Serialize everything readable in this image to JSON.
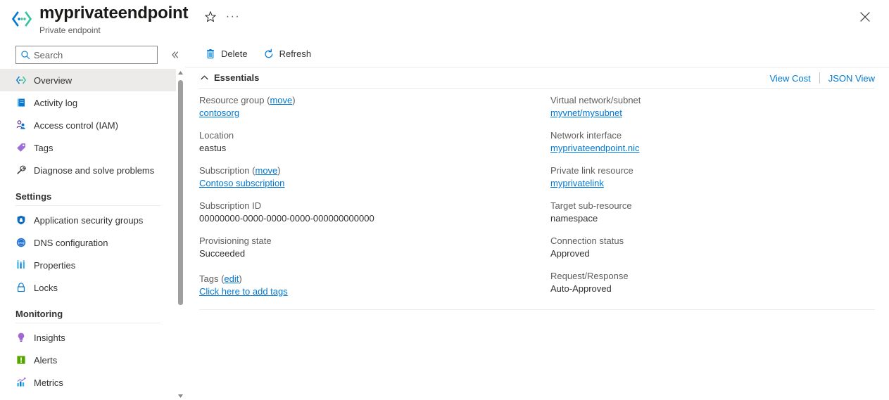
{
  "header": {
    "title": "myprivateendpoint",
    "subtitle": "Private endpoint",
    "resource_icon": "private-endpoint-icon",
    "favorite_icon": "star-icon",
    "more_icon": "ellipsis-icon",
    "close_icon": "close-icon"
  },
  "sidebar": {
    "search": {
      "placeholder": "Search",
      "value": "",
      "icon": "search-icon"
    },
    "collapse_icon": "chevron-double-left-icon",
    "items": [
      {
        "label": "Overview",
        "icon": "private-endpoint-icon",
        "selected": true
      },
      {
        "label": "Activity log",
        "icon": "activity-log-icon",
        "selected": false
      },
      {
        "label": "Access control (IAM)",
        "icon": "access-control-icon",
        "selected": false
      },
      {
        "label": "Tags",
        "icon": "tag-icon",
        "selected": false
      },
      {
        "label": "Diagnose and solve problems",
        "icon": "wrench-icon",
        "selected": false
      }
    ],
    "groups": [
      {
        "title": "Settings",
        "items": [
          {
            "label": "Application security groups",
            "icon": "shield-icon"
          },
          {
            "label": "DNS configuration",
            "icon": "dns-icon"
          },
          {
            "label": "Properties",
            "icon": "properties-icon"
          },
          {
            "label": "Locks",
            "icon": "lock-icon"
          }
        ]
      },
      {
        "title": "Monitoring",
        "items": [
          {
            "label": "Insights",
            "icon": "lightbulb-icon"
          },
          {
            "label": "Alerts",
            "icon": "alert-icon"
          },
          {
            "label": "Metrics",
            "icon": "metrics-icon"
          }
        ]
      }
    ]
  },
  "command_bar": {
    "buttons": [
      {
        "label": "Delete",
        "icon": "trash-icon"
      },
      {
        "label": "Refresh",
        "icon": "refresh-icon"
      }
    ]
  },
  "essentials": {
    "title": "Essentials",
    "collapse_icon": "chevron-up-icon",
    "view_cost": "View Cost",
    "json_view": "JSON View",
    "left_fields": [
      {
        "label": "Resource group",
        "link_suffix": "move",
        "value": "contosorg",
        "value_is_link": true
      },
      {
        "label": "Location",
        "link_suffix": "",
        "value": "eastus",
        "value_is_link": false
      },
      {
        "label": "Subscription",
        "link_suffix": "move",
        "value": "Contoso subscription",
        "value_is_link": true
      },
      {
        "label": "Subscription ID",
        "link_suffix": "",
        "value": "00000000-0000-0000-0000-000000000000",
        "value_is_link": false
      },
      {
        "label": "Provisioning state",
        "link_suffix": "",
        "value": "Succeeded",
        "value_is_link": false
      }
    ],
    "right_fields": [
      {
        "label": "Virtual network/subnet",
        "link_suffix": "",
        "value": "myvnet/mysubnet",
        "value_is_link": true
      },
      {
        "label": "Network interface",
        "link_suffix": "",
        "value": "myprivateendpoint.nic",
        "value_is_link": true
      },
      {
        "label": "Private link resource",
        "link_suffix": "",
        "value": "myprivatelink",
        "value_is_link": true
      },
      {
        "label": "Target sub-resource",
        "link_suffix": "",
        "value": "namespace",
        "value_is_link": false
      },
      {
        "label": "Connection status",
        "link_suffix": "",
        "value": "Approved",
        "value_is_link": false
      },
      {
        "label": "Request/Response",
        "link_suffix": "",
        "value": "Auto-Approved",
        "value_is_link": false
      }
    ],
    "tags": {
      "label": "Tags",
      "edit_link": "edit",
      "add_link": "Click here to add tags"
    }
  },
  "colors": {
    "accent": "#0078d4",
    "selected_row": "#edebe9",
    "text_primary": "#323130",
    "text_secondary": "#605e5c"
  }
}
